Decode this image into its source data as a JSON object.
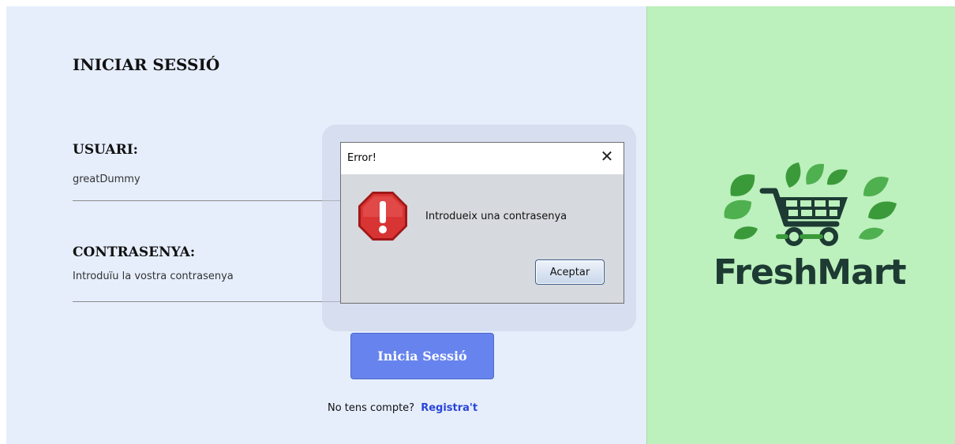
{
  "login": {
    "title": "INICIAR SESSIÓ",
    "user_label": "USUARI:",
    "user_value": "greatDummy",
    "password_label": "CONTRASENYA:",
    "password_placeholder": "Introduïu la vostra contrasenya",
    "login_button": "Inicia Sessió",
    "register_prompt": "No tens compte?",
    "register_link": "Registra't"
  },
  "dialog": {
    "title": "Error!",
    "close_icon": "close-icon",
    "icon": "error-stop-icon",
    "message": "Introdueix una contrasenya",
    "ok_button": "Aceptar"
  },
  "brand": {
    "name": "FreshMart",
    "logo_icon": "shopping-cart-leaves-icon"
  },
  "colors": {
    "login_bg": "#e6eefc",
    "brand_bg": "#bcf0bc",
    "accent": "#6784ee",
    "link": "#2a45d8",
    "logo_green": "#3a9a3a",
    "logo_dark": "#1d3a33"
  }
}
